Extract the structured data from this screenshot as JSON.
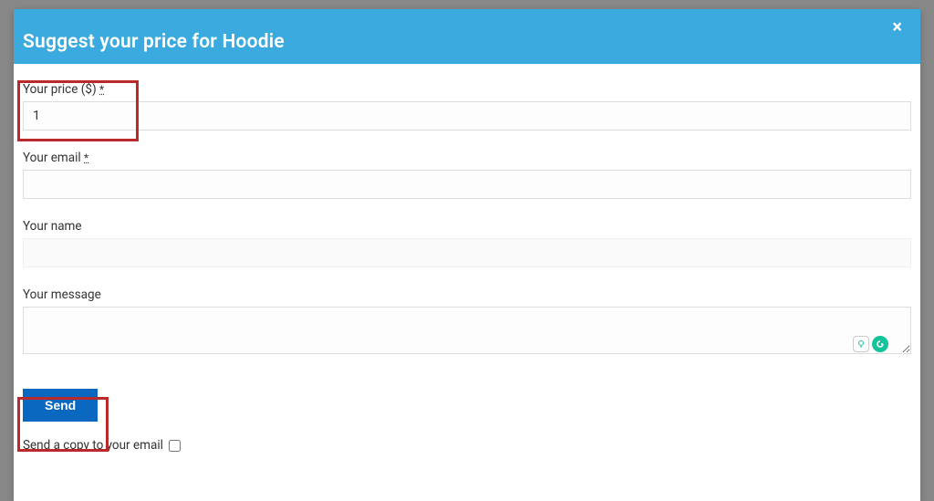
{
  "modal": {
    "title": "Suggest your price for Hoodie",
    "close_label": "×"
  },
  "form": {
    "price": {
      "label": "Your price ($)",
      "required": "*",
      "value": "1"
    },
    "email": {
      "label": "Your email",
      "required": "*",
      "value": ""
    },
    "name": {
      "label": "Your name",
      "value": ""
    },
    "message": {
      "label": "Your message",
      "value": ""
    },
    "send_button": "Send",
    "copy_checkbox": {
      "label": "Send a copy to your email",
      "checked": false
    }
  }
}
